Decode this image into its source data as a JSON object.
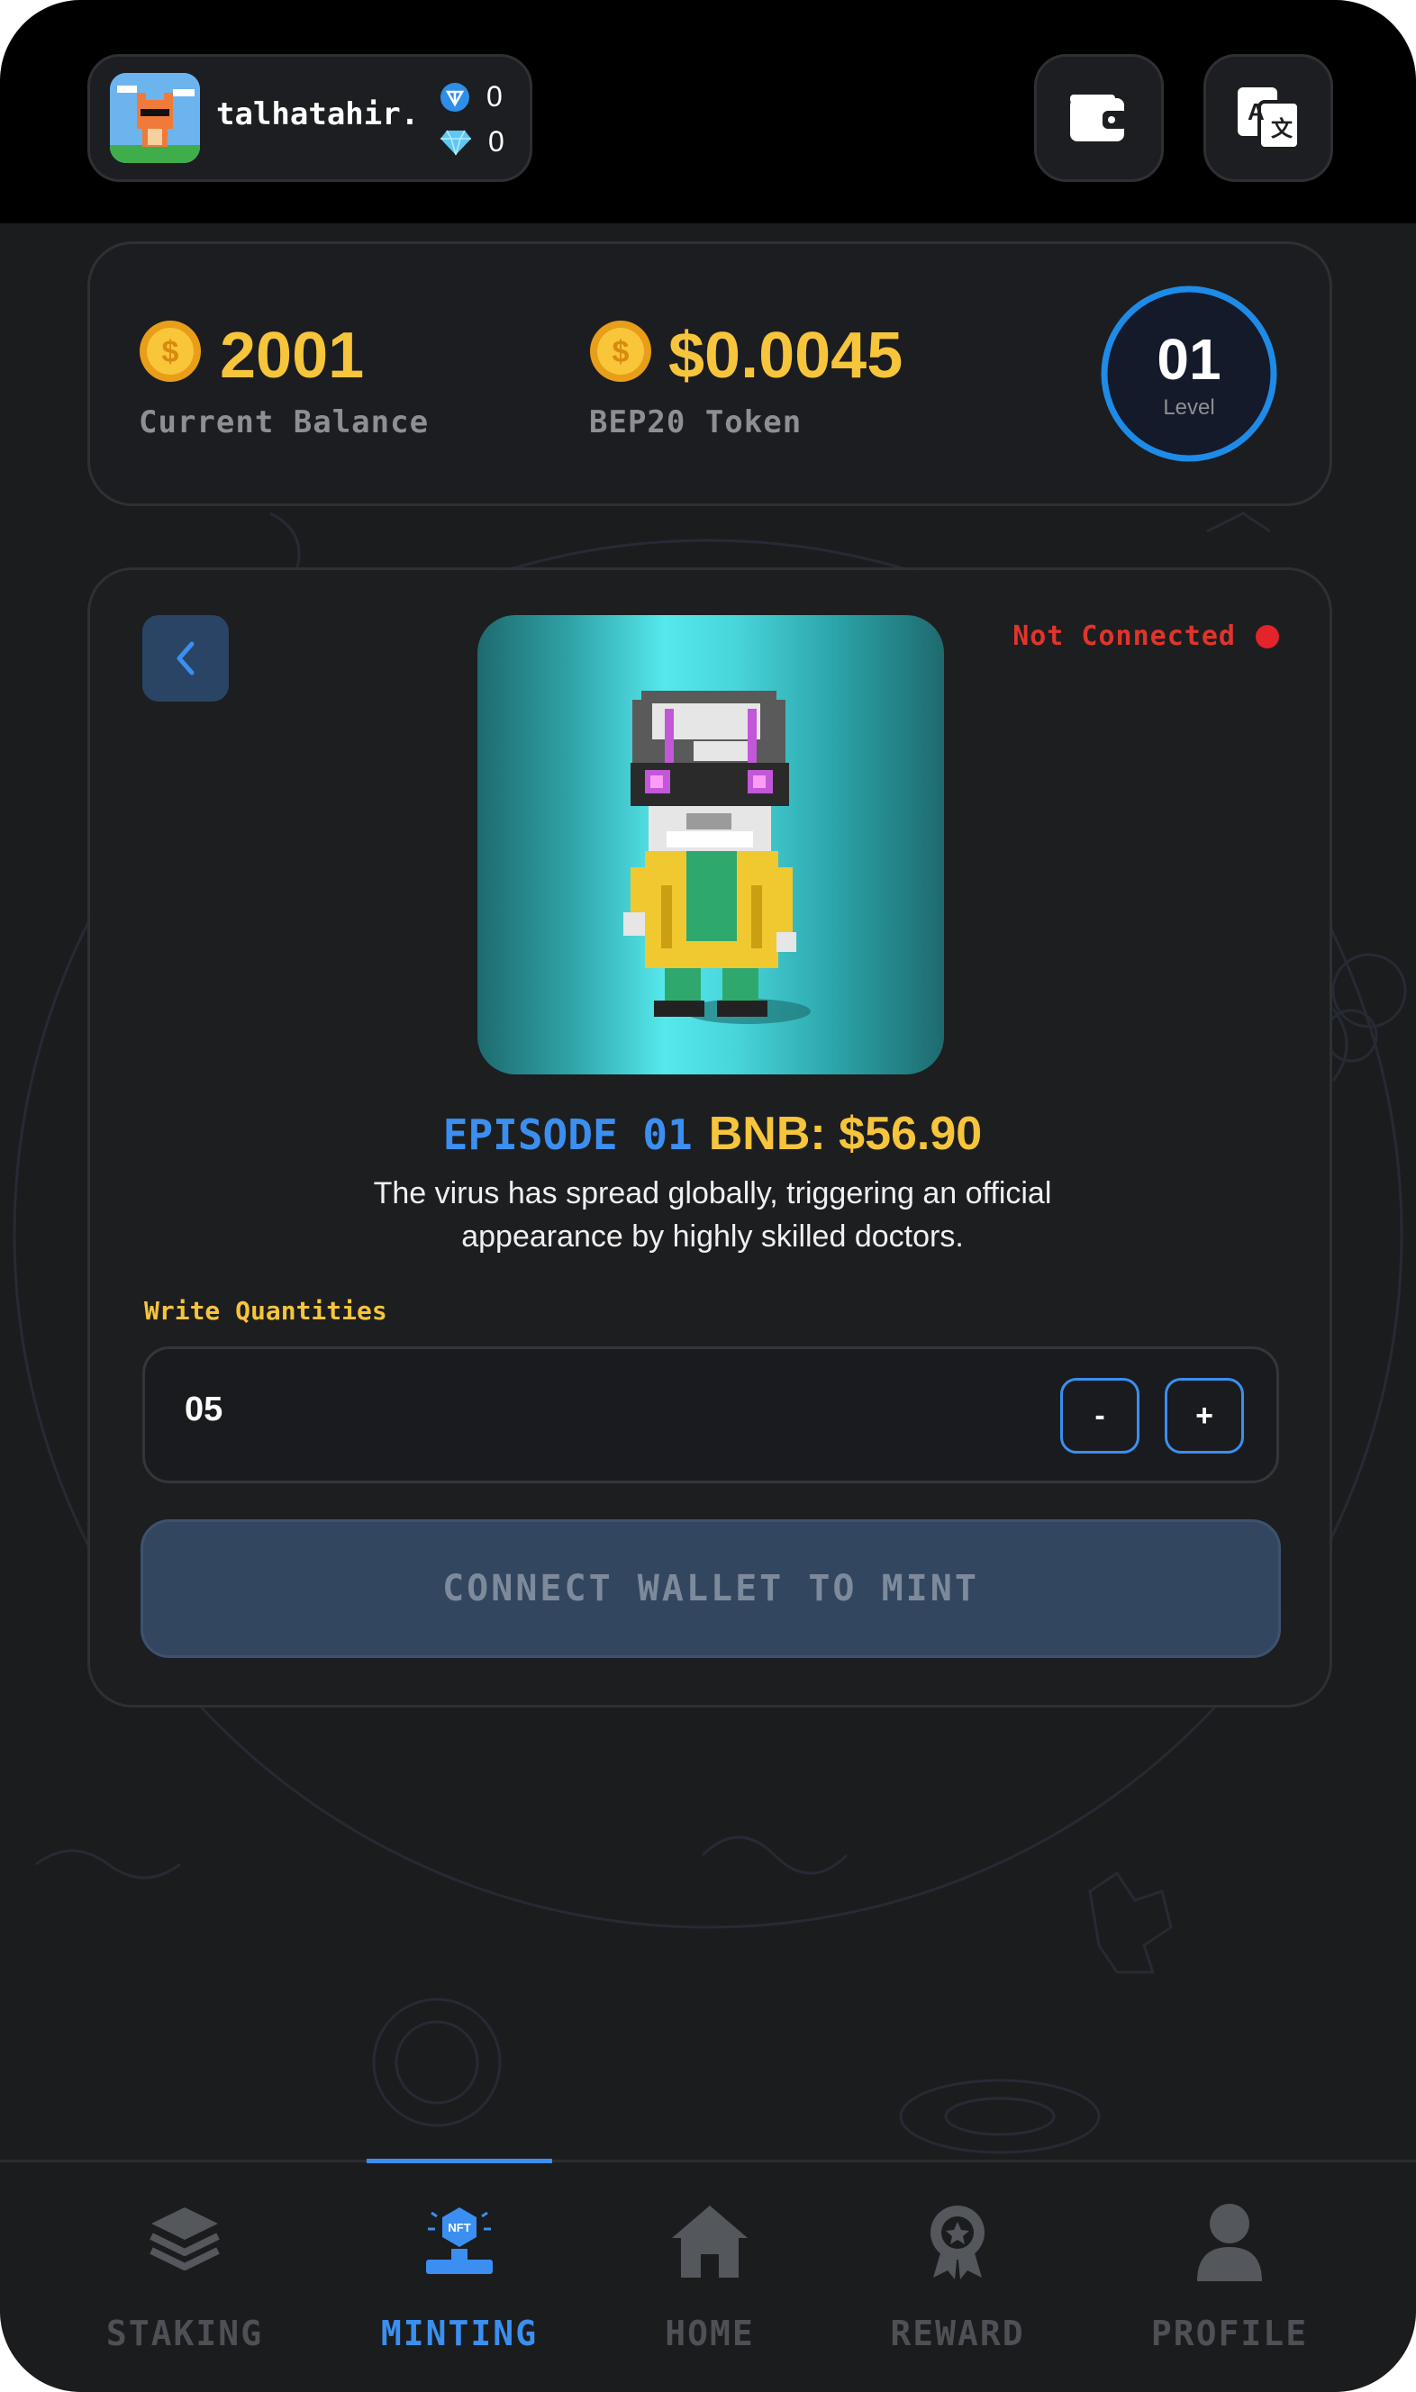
{
  "header": {
    "username": "talhatahir...",
    "ton_balance": "0",
    "diamond_balance": "0"
  },
  "balance": {
    "current_balance_value": "2001",
    "current_balance_label": "Current Balance",
    "token_value": "$0.0045",
    "token_label": "BEP20 Token",
    "level_value": "01",
    "level_label": "Level"
  },
  "mint": {
    "status_text": "Not Connected",
    "episode": "EPISODE 01",
    "price": "BNB: $56.90",
    "description_line1": "The virus has spread globally, triggering an official",
    "description_line2": "appearance by highly  skilled doctors.",
    "quantity_label": "Write Quantities",
    "quantity_value": "05",
    "minus_label": "-",
    "plus_label": "+",
    "mint_button_label": "CONNECT WALLET TO MINT"
  },
  "nav": {
    "items": [
      {
        "label": "STAKING",
        "icon": "layers-icon",
        "active": false
      },
      {
        "label": "MINTING",
        "icon": "nft-icon",
        "active": true
      },
      {
        "label": "HOME",
        "icon": "home-icon",
        "active": false
      },
      {
        "label": "REWARD",
        "icon": "reward-icon",
        "active": false
      },
      {
        "label": "PROFILE",
        "icon": "profile-icon",
        "active": false
      }
    ]
  },
  "colors": {
    "accent": "#3b8ff0",
    "gold": "#f6c53c",
    "danger": "#e3242b",
    "background": "#1b1c1e"
  }
}
